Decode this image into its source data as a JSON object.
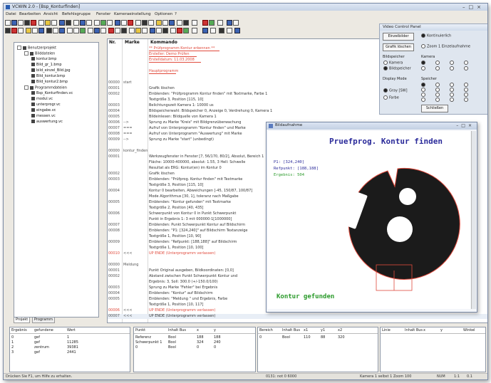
{
  "window": {
    "title": "VCWIN 2.0 - [Bsp_Konturfinden]"
  },
  "menu": [
    "Datei",
    "Bearbeiten",
    "Ansicht",
    "Befehlsgruppe",
    "Fenster",
    "Kameraeinstellung",
    "Optionen",
    "?"
  ],
  "tree": {
    "items": [
      {
        "label": "Benutzerprojekt",
        "level": 0,
        "exp": true
      },
      {
        "label": "Bilddateien",
        "level": 1,
        "exp": true
      },
      {
        "label": "kontur.bmp",
        "level": 2
      },
      {
        "label": "Bild_gr_1.bmp",
        "level": 2
      },
      {
        "label": "bild_einzel_Bild.jpg",
        "level": 2
      },
      {
        "label": "Bild_kontur.bmp",
        "level": 2
      },
      {
        "label": "Bild_kontur2.bmp",
        "level": 2
      },
      {
        "label": "Programmdateien",
        "level": 1,
        "exp": true
      },
      {
        "label": "Bsp_Konturfinden.vc",
        "level": 2
      },
      {
        "label": "modul.vc",
        "level": 2
      },
      {
        "label": "unterprogr.vc",
        "level": 2
      },
      {
        "label": "eingabe.vc",
        "level": 2
      },
      {
        "label": "messen.vc",
        "level": 2
      },
      {
        "label": "auswertung.vc",
        "level": 2
      }
    ]
  },
  "tree_tabs": [
    "Projekt",
    "Programm"
  ],
  "listing": {
    "headers": [
      "Nr.",
      "Marke",
      "Kommando"
    ],
    "rows": [
      {
        "n": "",
        "m": "",
        "c": "** Prüfprogramm Kontur erkennen **",
        "red": true
      },
      {
        "n": "",
        "m": "",
        "c": "Ersteller:  Demo Prüfen",
        "red": true
      },
      {
        "n": "",
        "m": "",
        "c": "Erstelldatum:  11.03.2008",
        "red": true
      },
      {
        "n": "",
        "m": "",
        "c": "",
        "red": false
      },
      {
        "n": "",
        "m": "",
        "c": "Hauptprogramm",
        "red": true
      },
      {
        "n": "",
        "m": "",
        "c": "",
        "red": false
      },
      {
        "n": "00000",
        "m": "start",
        "c": "",
        "red": false
      },
      {
        "n": "00001",
        "m": "",
        "c": "Grafik löschen",
        "red": false
      },
      {
        "n": "00002",
        "m": "",
        "c": "Einblenden:  \"Prüfprogramm Kontur finden\" mit Textmarke, Farbe 1",
        "red": false
      },
      {
        "n": "",
        "m": "",
        "c": "Textgröße 3, Position [115, 10]",
        "red": false
      },
      {
        "n": "00003",
        "m": "",
        "c": "Belichtungszeit Kamera 1: 10000 us",
        "red": false
      },
      {
        "n": "00004",
        "m": "",
        "c": "Bildspeicherwahl: Bildspeicher 0, Anzeige 0, Verdrehung 0, Kamera 1",
        "red": false
      },
      {
        "n": "00005",
        "m": "",
        "c": "Bildeinlesen: Bildquelle von Kamera 1",
        "red": false
      },
      {
        "n": "00006",
        "m": "-->",
        "c": "Sprung zu Marke \"Kreis\" mit Bildgrenzüberwachung",
        "red": false
      },
      {
        "n": "00007",
        "m": "===",
        "c": "Aufruf von Unterprogramm \"Kontur finden\" und Marke",
        "red": false
      },
      {
        "n": "00008",
        "m": "===",
        "c": "Aufruf von Unterprogramm \"Auswertung\" mit Marke",
        "red": false
      },
      {
        "n": "00009",
        "m": "-->",
        "c": "Sprung zu Marke \"start\" (unbedingt)",
        "red": false
      },
      {
        "n": "",
        "m": "",
        "c": "",
        "red": false
      },
      {
        "n": "00000",
        "m": "kontur_finden",
        "c": "",
        "red": false
      },
      {
        "n": "00001",
        "m": "",
        "c": "Werkzeugfenster in Fenster [7, 56/170, 80/2], Absolut, Bereich 1",
        "red": false
      },
      {
        "n": "",
        "m": "",
        "c": "Fläche: 10000-400000, absolut: 1.55, 3 Hell: Schwelle",
        "red": false
      },
      {
        "n": "",
        "m": "",
        "c": "Resultat als ERG: Kontur(en) im Kontur 0",
        "red": false
      },
      {
        "n": "00002",
        "m": "",
        "c": "Grafik löschen",
        "red": false
      },
      {
        "n": "00003",
        "m": "",
        "c": "Einblenden:  \"Prüfprog. Kontur finden\" mit Textmarke",
        "red": false
      },
      {
        "n": "",
        "m": "",
        "c": "Textgröße 3, Position [115, 10]",
        "red": false
      },
      {
        "n": "00004",
        "m": "",
        "c": "Kontur 0 bearbeiten, Abweichungen [-45, 150/87, 100/87]",
        "red": false
      },
      {
        "n": "",
        "m": "",
        "c": "Mode Algorithmus [30, 1], toleranz nach Maßgabe",
        "red": false
      },
      {
        "n": "00005",
        "m": "",
        "c": "Einblenden:  \"Kontur gefunden\" mit Textmarke",
        "red": false
      },
      {
        "n": "",
        "m": "",
        "c": "Textgröße 2, Position [40, 435]",
        "red": false
      },
      {
        "n": "00006",
        "m": "",
        "c": "Schwerpunkt von Kontur 0 in Punkt Schwerpunkt",
        "red": false
      },
      {
        "n": "",
        "m": "",
        "c": "Punkt in Ergebnis 1: 3 mit 000000-1[1000000]",
        "red": false
      },
      {
        "n": "00007",
        "m": "",
        "c": "Einblenden: Punkt Schwerpunkt Kontur auf Bildschirm",
        "red": false
      },
      {
        "n": "00008",
        "m": "",
        "c": "Einblenden:  \"P1: [324,240]\" auf Bildschirm Textanzeige",
        "red": false
      },
      {
        "n": "",
        "m": "",
        "c": "Textgröße 1, Position [10, 90]",
        "red": false
      },
      {
        "n": "00009",
        "m": "",
        "c": "Einblenden:  \"Refpunkt: [188,188]\" auf Bildschirm",
        "red": false
      },
      {
        "n": "",
        "m": "",
        "c": "Textgröße 1, Position [10, 100]",
        "red": false
      },
      {
        "n": "00010",
        "m": "<<<",
        "c": "UP ENDE (Unterprogramm verlassen)",
        "red": true
      },
      {
        "n": "",
        "m": "",
        "c": "",
        "red": false
      },
      {
        "n": "00000",
        "m": "Meldung",
        "c": "",
        "red": false
      },
      {
        "n": "00001",
        "m": "",
        "c": "Punkt Original ausgeben, Bildkoordinaten: [0,0]",
        "red": false
      },
      {
        "n": "00002",
        "m": "",
        "c": "Abstand zwischen Punkt Schwerpunkt Kontur und",
        "red": false
      },
      {
        "n": "",
        "m": "",
        "c": "Ergebnis: 3, Soll: 300.0 (+/-150.0/100)",
        "red": false
      },
      {
        "n": "00003",
        "m": "",
        "c": "Sprung zu Marke \"Fehler\" bei Ergebnis",
        "red": false
      },
      {
        "n": "00004",
        "m": "",
        "c": "Einblenden:  \"Kontur\" auf Bildschirm",
        "red": false
      },
      {
        "n": "00005",
        "m": "",
        "c": "Einblenden:  \"Meldung \" und Ergebnis, Farbe",
        "red": false
      },
      {
        "n": "",
        "m": "",
        "c": "Textgröße 1, Position [10, 117]",
        "red": false
      },
      {
        "n": "00006",
        "m": "<<<",
        "c": "UP ENDE (Unterprogramm verlassen)",
        "red": true
      },
      {
        "n": "00007",
        "m": "<<<",
        "c": "UP ENDE (Unterprogramm verlassen)",
        "red": false,
        "hl": true
      }
    ]
  },
  "control_panel": {
    "title": "Video Control Panel",
    "btn_live": "Einzelbilder",
    "btn_grab": "Grafik löschen",
    "radio_cont": "Kontinuierlich",
    "radio_single": "Zoom 1 Einzelaufnahme",
    "grp_bild": "Bildspeicher",
    "r_kamera": "Kamera",
    "r_bild": "Bildspeicher",
    "grp_kamera": "Kamera",
    "grp_display": "Display Mode",
    "r_gray": "Gray [SW]",
    "r_color": "Farbe",
    "grp_speicher": "Speicher",
    "close_label": "Schließen"
  },
  "image_window": {
    "title": "Bildaufnahme",
    "heading": "Pruefprog. Kontur finden",
    "p1": "P1: [324,240]",
    "ref": "Refpunkt: [188,188]",
    "result": "Ergebnis: 504",
    "found": "Kontur gefunden"
  },
  "bottom": {
    "p1_headers": [
      "Ergebnis",
      "gefundene",
      "Wert"
    ],
    "p1_rows": [
      [
        "0",
        "gef",
        "1"
      ],
      [
        "1",
        "gef",
        "11285"
      ],
      [
        "2",
        "zentrum",
        "39381"
      ],
      [
        "3",
        "gef",
        "2441"
      ]
    ],
    "p2_headers": [
      "Punkt",
      "Inhalt Bus",
      "x",
      "y"
    ],
    "p2_rows": [
      [
        "Referenz",
        "Bool",
        "188",
        "188"
      ],
      [
        "Schwerpunkt 1",
        "Bool",
        "324",
        "240"
      ],
      [
        "0",
        "Bool",
        "0",
        "0"
      ]
    ],
    "p3_headers": [
      "Bereich",
      "Inhalt Bus",
      "x1",
      "y1",
      "x2"
    ],
    "p3_rows": [
      [
        "0",
        "Bool",
        "110",
        "88",
        "320"
      ]
    ],
    "p4_headers": [
      "Linie",
      "Inhalt Bus",
      "x",
      "y",
      "Winkel"
    ],
    "p4_rows": []
  },
  "status": {
    "left": "Drücken Sie F1, um Hilfe zu erhalten.",
    "mid": "0131: not 0 6000",
    "coords": "Kamera 1  selbst 1  Zoom 100",
    "flags": "NUM",
    "res": "1:1",
    "res2": "0.1"
  }
}
